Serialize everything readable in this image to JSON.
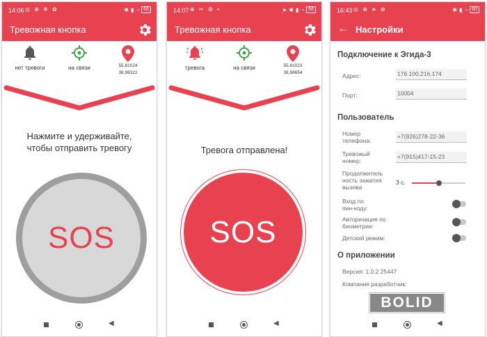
{
  "colors": {
    "accent": "#e8414f",
    "gray_button": "#d8d8d8",
    "gray_ring": "#9e9e9e",
    "green": "#43a047"
  },
  "screen1": {
    "status": {
      "time": "14:06",
      "left_icons": "◎ ⊕ ❄ ✿",
      "battery": "66"
    },
    "title": "Тревожная кнопка",
    "settings_icon": "gear-icon",
    "indicators": {
      "alarm_label": "нет тревоги",
      "connection_label": "на связи",
      "lat": "55,81024",
      "lon": "38,98322"
    },
    "message": [
      "Нажмите и удерживайте,",
      "чтобы отправить тревогу"
    ],
    "sos": "SOS"
  },
  "screen2": {
    "status": {
      "time": "14:07",
      "left_icons": "⊕ ✂ ⚙ •",
      "battery": "66"
    },
    "title": "Тревожная кнопка",
    "settings_icon": "gear-icon",
    "indicators": {
      "alarm_label": "тревога",
      "connection_label": "на связи",
      "lat": "55,81023",
      "lon": "38,98654"
    },
    "message": [
      "Тревога отправлена!"
    ],
    "sos": "SOS"
  },
  "screen3": {
    "status": {
      "time": "16:43",
      "left_icons": "◎ ⊕ ➤ ⊗",
      "battery": "60"
    },
    "title": "Настройки",
    "connection": {
      "heading": "Подключение к Эгида-3",
      "address_label": "Адрес:",
      "address_value": "176.100.216.174",
      "port_label": "Порт:",
      "port_value": "10004"
    },
    "user": {
      "heading": "Пользователь",
      "phone_label": [
        "Номер",
        "телефона:"
      ],
      "phone_value": "+7(926)278-22-36",
      "alarm_phone_label": [
        "Тревожый",
        "номер:"
      ],
      "alarm_phone_value": "+7(915)417-15-23",
      "duration_label": [
        "Продолжитель",
        "ность зажатия",
        "вызова"
      ],
      "duration_value": "3 с.",
      "duration_fraction": 0.5,
      "pin_label": [
        "Вход по",
        "пин-коду:"
      ],
      "bio_label": [
        "Авторизация по",
        "биометрии:"
      ],
      "kids_label": [
        "Детский режим:"
      ]
    },
    "about": {
      "heading": "О приложении",
      "version": "Версия: 1.0.2.25447",
      "developer": "Компания разработчик:",
      "logo": "BOLID"
    }
  }
}
